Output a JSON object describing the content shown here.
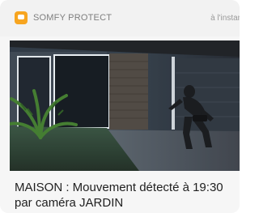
{
  "notification": {
    "app_name": "SOMFY PROTECT",
    "time": "à l'instant",
    "app_icon": "somfy-protect-app-icon",
    "message": "MAISON : Mouvement détecté à 19:30 par caméra JARDIN"
  },
  "camera_snapshot": {
    "icon": "camera-snapshot-image"
  },
  "colors": {
    "accent": "#f7a520",
    "header_bg": "#f2f2f2",
    "text_primary": "#1f1f1f",
    "text_secondary": "#7e7e7e"
  }
}
